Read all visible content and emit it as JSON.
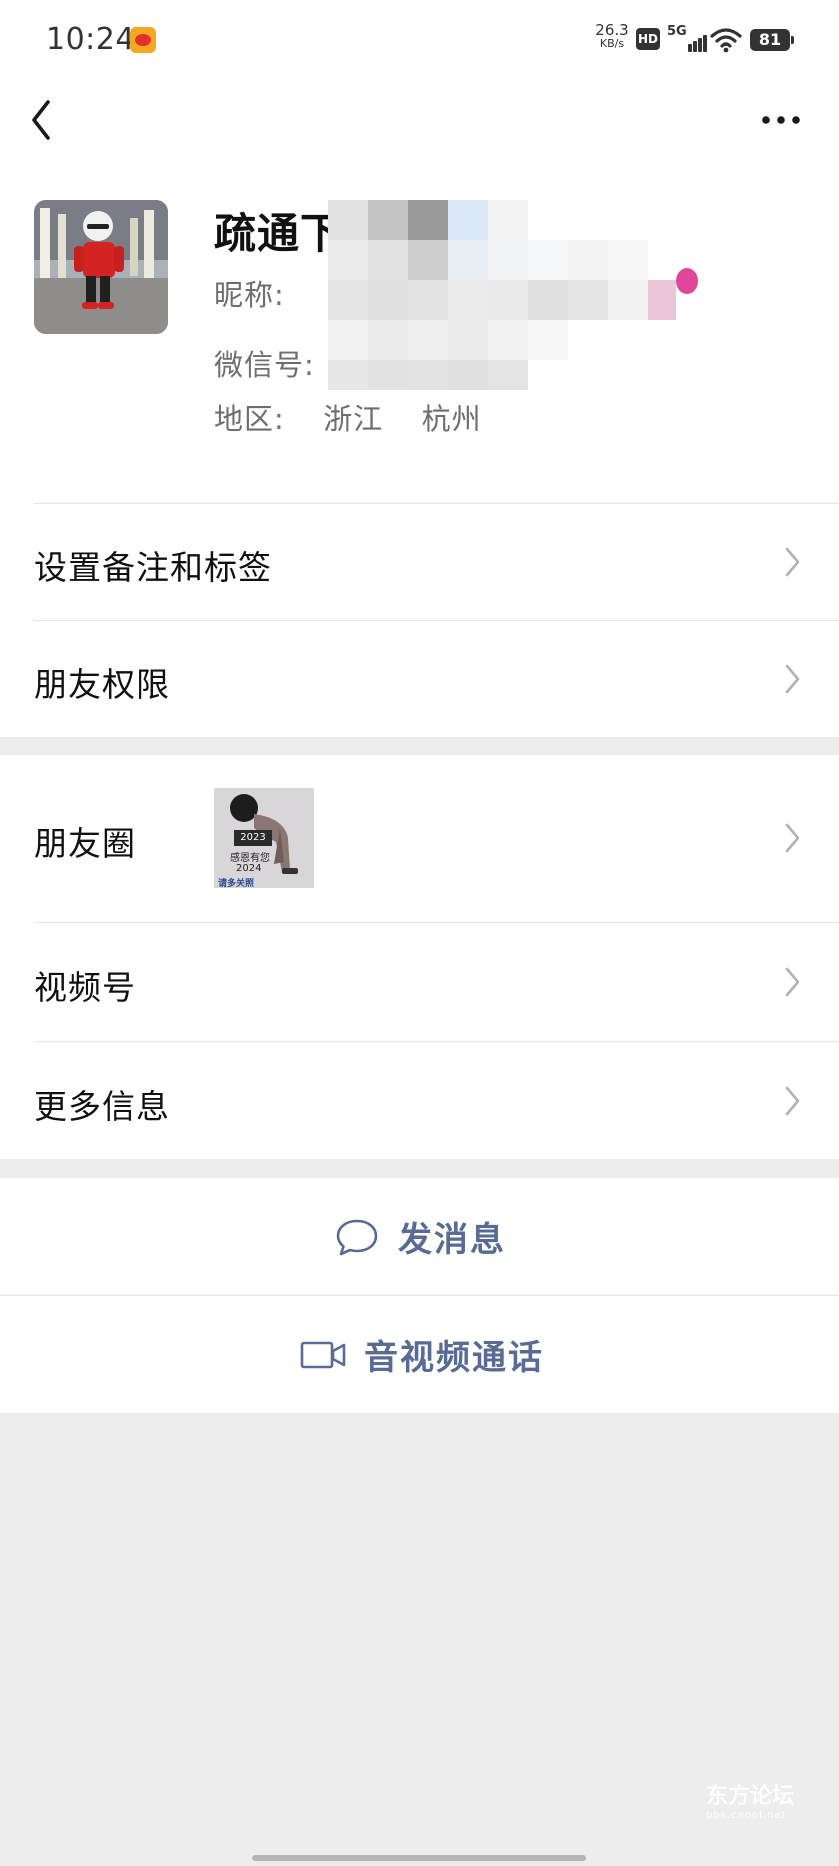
{
  "status_bar": {
    "time": "10:24",
    "net_speed_value": "26.3",
    "net_speed_unit": "KB/s",
    "hd_label": "HD",
    "network_label": "5G",
    "battery_level": "81"
  },
  "profile": {
    "name_visible": "疏通下",
    "nickname_label": "昵称:",
    "wechat_id_label": "微信号:",
    "region_label": "地区:",
    "region_province": "浙江",
    "region_city": "杭州"
  },
  "menu": {
    "remark_tags": "设置备注和标签",
    "friend_permissions": "朋友权限",
    "moments": "朋友圈",
    "channels": "视频号",
    "more_info": "更多信息"
  },
  "moments_thumb": {
    "year_top": "2023",
    "caption": "感恩有您",
    "year_bottom": "2024",
    "footer": "请多关照"
  },
  "actions": {
    "send_message": "发消息",
    "video_call": "音视频通话"
  },
  "watermark": {
    "brand": "东方论坛",
    "url": "bbs.cnool.net"
  }
}
